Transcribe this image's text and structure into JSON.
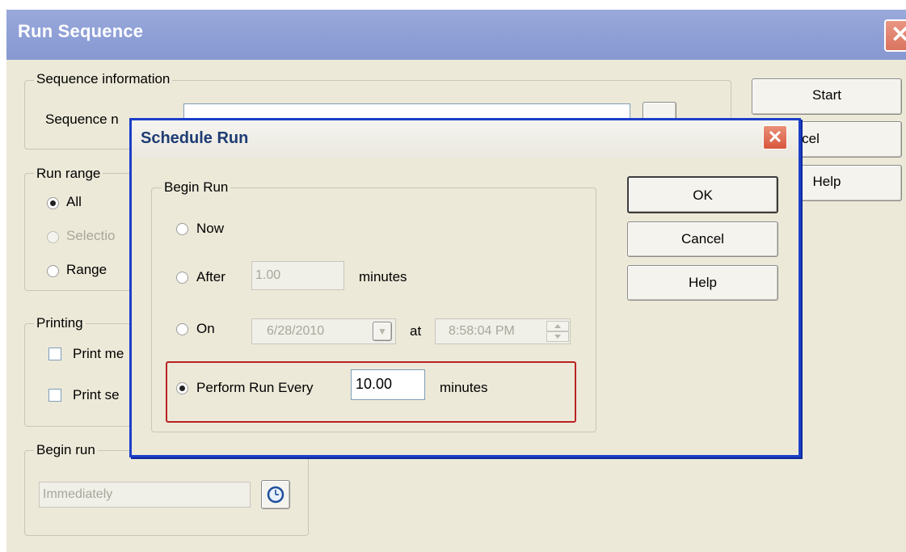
{
  "outer": {
    "title": "Run Sequence",
    "close_glyph": "✕",
    "sequence_group": {
      "legend": "Sequence information",
      "name_label": "Sequence n"
    },
    "run_range": {
      "legend": "Run range",
      "options": [
        "All",
        "Selectio",
        "Range"
      ],
      "selected": "All"
    },
    "printing": {
      "legend": "Printing",
      "options": [
        "Print me",
        "Print se"
      ]
    },
    "begin_run": {
      "legend": "Begin run",
      "value": "Immediately",
      "timer_icon": "clock-icon"
    },
    "buttons": {
      "start": "Start",
      "cancel": "Cancel",
      "help": "Help"
    }
  },
  "dialog": {
    "title": "Schedule Run",
    "close_glyph": "✕",
    "group_legend": "Begin Run",
    "now_label": "Now",
    "after": {
      "label": "After",
      "value": "1.00",
      "unit": "minutes"
    },
    "on": {
      "label": "On",
      "date": "6/28/2010",
      "at_label": "at",
      "time": "8:58:04 PM"
    },
    "every": {
      "label": "Perform Run Every",
      "value": "10.00",
      "unit": "minutes"
    },
    "selected": "Perform Run Every",
    "buttons": {
      "ok": "OK",
      "cancel": "Cancel",
      "help": "Help"
    }
  },
  "colors": {
    "highlight": "#b92222",
    "dialog_border": "#1b3fc9",
    "title_bar": "#8e9fd6"
  }
}
